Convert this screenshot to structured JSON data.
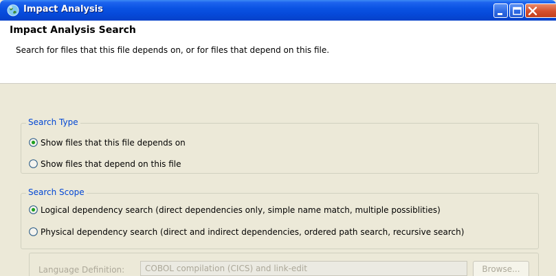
{
  "window": {
    "title": "Impact Analysis"
  },
  "header": {
    "title": "Impact Analysis Search",
    "description": "Search for files that this file depends on, or for files that depend on this file."
  },
  "search_type": {
    "label": "Search Type",
    "options": [
      {
        "label": "Show files that this file depends on",
        "selected": true
      },
      {
        "label": "Show files that depend on this file",
        "selected": false
      }
    ]
  },
  "search_scope": {
    "label": "Search Scope",
    "options": [
      {
        "label": "Logical dependency search  (direct dependencies only, simple name match, multiple possiblities)",
        "selected": true
      },
      {
        "label": "Physical dependency search (direct and indirect dependencies, ordered path search, recursive search)",
        "selected": false
      }
    ]
  },
  "language": {
    "label": "Language Definition:",
    "value": "COBOL compilation (CICS) and link-edit",
    "browse_label": "Browse...",
    "enabled": false
  },
  "colors": {
    "titlebar": "#0a53e3",
    "group_label": "#0046d5",
    "dialog_bg": "#ece9d8",
    "disabled_text": "#aca899"
  }
}
